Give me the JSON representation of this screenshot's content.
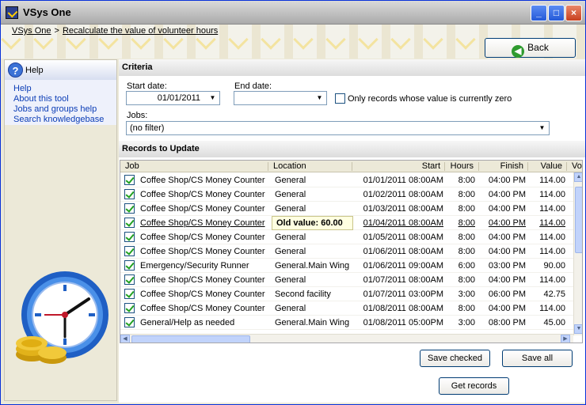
{
  "window": {
    "title": "VSys One"
  },
  "titlebar_buttons": {
    "minimize": "_",
    "maximize": "□",
    "close": "×"
  },
  "breadcrumb": {
    "home": "VSys One",
    "separator": ">",
    "current": "Recalculate the value of volunteer hours"
  },
  "back_button": {
    "label": "Back",
    "icon": "back-arrow-icon"
  },
  "help_panel": {
    "title": "Help",
    "links": [
      "Help",
      "About this tool",
      "Jobs and groups help",
      "Search knowledgebase"
    ]
  },
  "criteria": {
    "heading": "Criteria",
    "start_date_label": "Start date:",
    "start_date_value": "01/01/2011",
    "end_date_label": "End date:",
    "end_date_value": "",
    "zero_only_label": "Only records whose value is currently zero",
    "zero_only_checked": false,
    "jobs_label": "Jobs:",
    "jobs_value": "(no filter)"
  },
  "records": {
    "heading": "Records to Update",
    "columns": [
      "Job",
      "Location",
      "Start",
      "Hours",
      "Finish",
      "Value",
      "Vol"
    ],
    "tooltip": "Old value: 60.00",
    "rows": [
      {
        "checked": true,
        "job": "Coffee Shop/CS Money Counter",
        "location": "General",
        "start": "01/01/2011 08:00AM",
        "hours": "8:00",
        "finish": "04:00 PM",
        "value": "114.00"
      },
      {
        "checked": true,
        "job": "Coffee Shop/CS Money Counter",
        "location": "General",
        "start": "01/02/2011 08:00AM",
        "hours": "8:00",
        "finish": "04:00 PM",
        "value": "114.00"
      },
      {
        "checked": true,
        "job": "Coffee Shop/CS Money Counter",
        "location": "General",
        "start": "01/03/2011 08:00AM",
        "hours": "8:00",
        "finish": "04:00 PM",
        "value": "114.00"
      },
      {
        "checked": true,
        "job": "Coffee Shop/CS Money Counter",
        "location": "",
        "start": "01/04/2011 08:00AM",
        "hours": "8:00",
        "finish": "04:00 PM",
        "value": "114.00",
        "hovered": true
      },
      {
        "checked": true,
        "job": "Coffee Shop/CS Money Counter",
        "location": "General",
        "start": "01/05/2011 08:00AM",
        "hours": "8:00",
        "finish": "04:00 PM",
        "value": "114.00"
      },
      {
        "checked": true,
        "job": "Coffee Shop/CS Money Counter",
        "location": "General",
        "start": "01/06/2011 08:00AM",
        "hours": "8:00",
        "finish": "04:00 PM",
        "value": "114.00"
      },
      {
        "checked": true,
        "job": "Emergency/Security Runner",
        "location": "General.Main Wing",
        "start": "01/06/2011 09:00AM",
        "hours": "6:00",
        "finish": "03:00 PM",
        "value": "90.00"
      },
      {
        "checked": true,
        "job": "Coffee Shop/CS Money Counter",
        "location": "General",
        "start": "01/07/2011 08:00AM",
        "hours": "8:00",
        "finish": "04:00 PM",
        "value": "114.00"
      },
      {
        "checked": true,
        "job": "Coffee Shop/CS Money Counter",
        "location": "Second facility",
        "start": "01/07/2011 03:00PM",
        "hours": "3:00",
        "finish": "06:00 PM",
        "value": "42.75"
      },
      {
        "checked": true,
        "job": "Coffee Shop/CS Money Counter",
        "location": "General",
        "start": "01/08/2011 08:00AM",
        "hours": "8:00",
        "finish": "04:00 PM",
        "value": "114.00"
      },
      {
        "checked": true,
        "job": "General/Help as needed",
        "location": "General.Main Wing",
        "start": "01/08/2011 05:00PM",
        "hours": "3:00",
        "finish": "08:00 PM",
        "value": "45.00"
      }
    ]
  },
  "actions": {
    "save_checked": "Save checked",
    "save_all": "Save all",
    "get_records": "Get records"
  },
  "illustration": {
    "icon": "clock-with-coins-icon"
  }
}
